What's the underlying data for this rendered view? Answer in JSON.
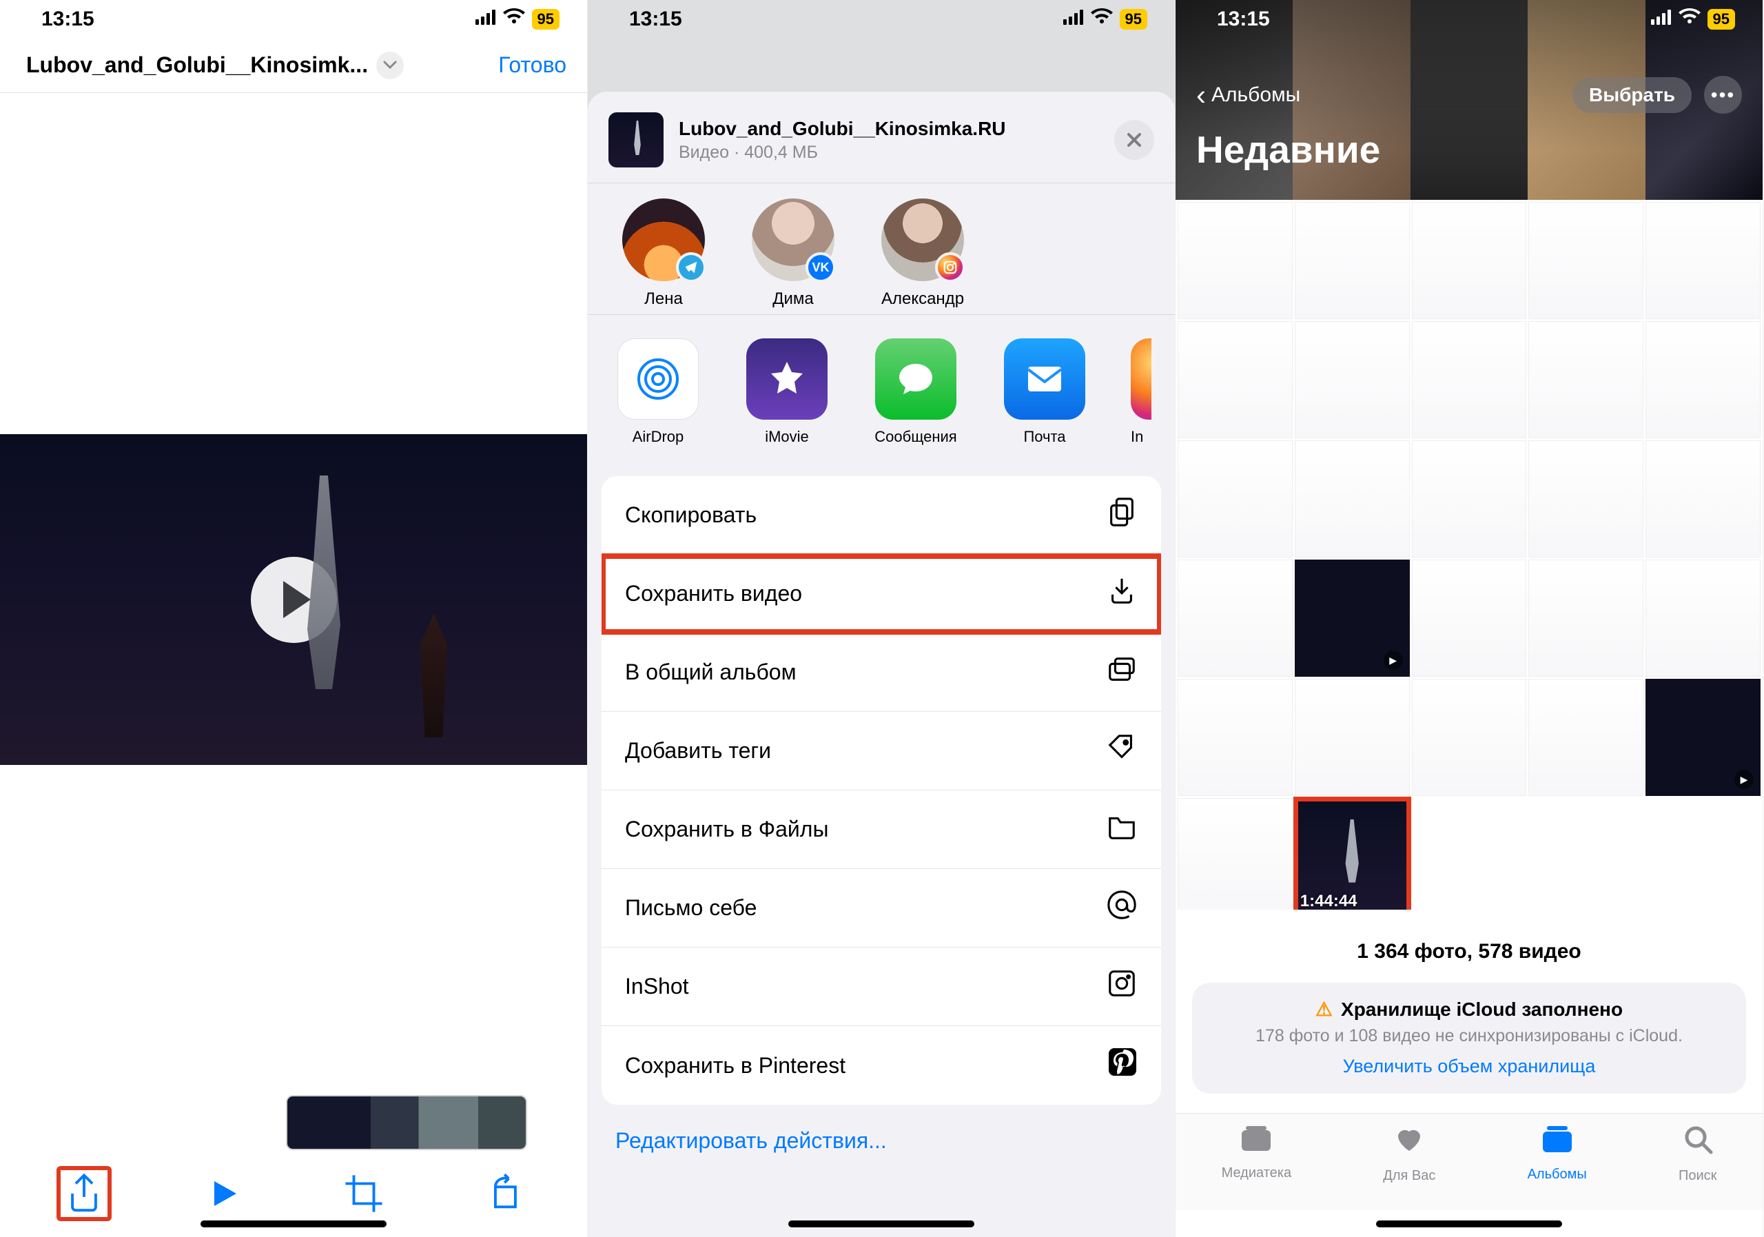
{
  "status": {
    "time": "13:15",
    "battery": "95"
  },
  "screen1": {
    "title": "Lubov_and_Golubi__Kinosimk...",
    "done": "Готово"
  },
  "screen2": {
    "file_title": "Lubov_and_Golubi__Kinosimka.RU",
    "file_sub": "Видео · 400,4 МБ",
    "contacts": [
      {
        "name": "Лена",
        "net": "tg"
      },
      {
        "name": "Дима",
        "net": "vk"
      },
      {
        "name": "Александр",
        "net": "ig"
      }
    ],
    "apps": [
      {
        "name": "AirDrop"
      },
      {
        "name": "iMovie"
      },
      {
        "name": "Сообщения"
      },
      {
        "name": "Почта"
      },
      {
        "name": "In"
      }
    ],
    "actions": {
      "copy": "Скопировать",
      "save_video": "Сохранить видео",
      "shared_album": "В общий альбом",
      "add_tags": "Добавить теги",
      "save_files": "Сохранить в Файлы",
      "mail_self": "Письмо себе",
      "inshot": "InShot",
      "pinterest": "Сохранить в Pinterest"
    },
    "edit_actions": "Редактировать действия..."
  },
  "screen3": {
    "back": "Альбомы",
    "select": "Выбрать",
    "title": "Недавние",
    "video_duration": "1:44:44",
    "count": "1 364 фото, 578 видео",
    "banner": {
      "line1": "Хранилище iCloud заполнено",
      "line2": "178 фото и 108 видео не синхронизированы с iCloud.",
      "line3": "Увеличить объем хранилища"
    },
    "tabs": {
      "library": "Медиатека",
      "for_you": "Для Вас",
      "albums": "Альбомы",
      "search": "Поиск"
    }
  }
}
